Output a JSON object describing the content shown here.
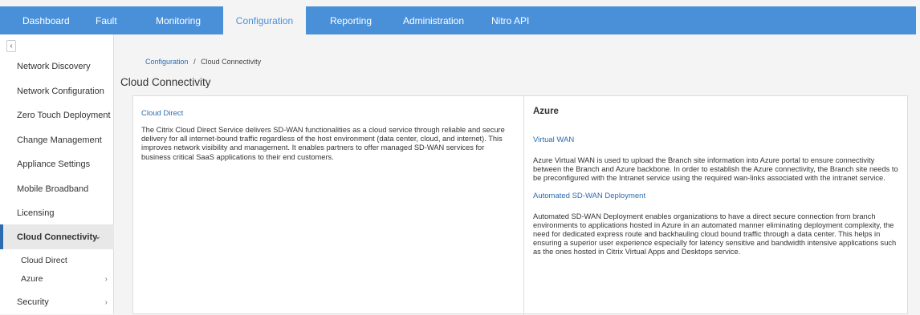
{
  "topnav": {
    "tabs": [
      {
        "label": "Dashboard"
      },
      {
        "label": "Fault"
      },
      {
        "label": "Monitoring"
      },
      {
        "label": "Configuration"
      },
      {
        "label": "Reporting"
      },
      {
        "label": "Administration"
      },
      {
        "label": "Nitro API"
      }
    ],
    "active_tab": "Configuration",
    "accent_color": "#4a90d9"
  },
  "sidebar": {
    "items": [
      {
        "label": "Network Discovery"
      },
      {
        "label": "Network Configuration"
      },
      {
        "label": "Zero Touch Deployment"
      },
      {
        "label": "Change Management"
      },
      {
        "label": "Appliance Settings"
      },
      {
        "label": "Mobile Broadband"
      },
      {
        "label": "Licensing"
      },
      {
        "label": "Cloud Connectivity"
      },
      {
        "label": "Security"
      }
    ],
    "sub_items": [
      {
        "label": "Cloud Direct"
      },
      {
        "label": "Azure"
      }
    ]
  },
  "breadcrumb": {
    "parent": "Configuration",
    "separator": "/",
    "current": "Cloud Connectivity"
  },
  "page": {
    "title": "Cloud Connectivity"
  },
  "cloud_direct": {
    "title": "Cloud Direct",
    "description": "The Citrix Cloud Direct Service delivers SD-WAN functionalities as a cloud service through reliable and secure delivery for all internet-bound traffic regardless of the host environment (data center, cloud, and internet). This improves network visibility and management. It enables partners to offer managed SD-WAN services for business critical SaaS applications to their end customers."
  },
  "azure": {
    "title": "Azure",
    "virtual_wan_title": "Virtual WAN",
    "virtual_wan_desc": "Azure Virtual WAN is used to upload the Branch site information into Azure portal to ensure connectivity between the Branch and Azure backbone. In order to establish the Azure connectivity, the Branch site needs to be preconfigured with the Intranet service using the required wan-links associated with the intranet service.",
    "automated_title": "Automated SD-WAN Deployment",
    "automated_desc": "Automated SD-WAN Deployment enables organizations to have a direct secure connection from branch environments to applications hosted in Azure in an automated manner eliminating deployment complexity, the need for dedicated express route and backhauling cloud bound traffic through a data center. This helps in ensuring a superior user experience especially for latency sensitive and bandwidth intensive applications such as the ones hosted in Citrix Virtual Apps and Desktops service."
  }
}
